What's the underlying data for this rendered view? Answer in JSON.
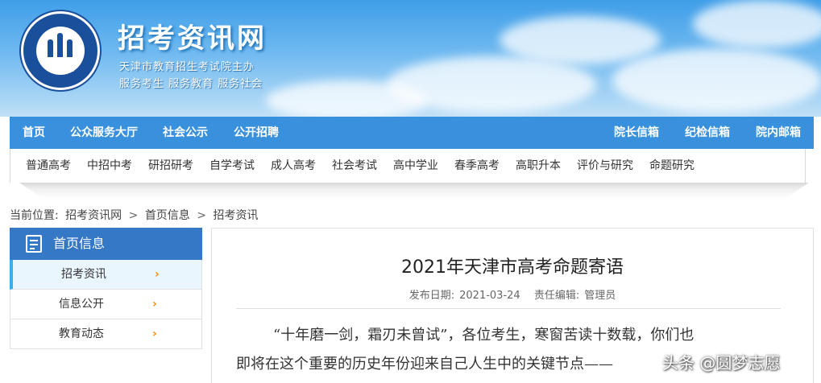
{
  "header": {
    "site_title": "招考资讯网",
    "logo_text": "TAEA",
    "subtitle_line1": "天津市教育招生考试院主办",
    "subtitle_line2": "服务考生 服务教育 服务社会"
  },
  "top_nav": {
    "left": [
      "首页",
      "公众服务大厅",
      "社会公示",
      "公开招聘"
    ],
    "right": [
      "院长信箱",
      "纪检信箱",
      "院内邮箱"
    ]
  },
  "sub_nav": [
    "普通高考",
    "中招中考",
    "研招研考",
    "自学考试",
    "成人高考",
    "社会考试",
    "高中学业",
    "春季高考",
    "高职升本",
    "评价与研究",
    "命题研究"
  ],
  "breadcrumb": {
    "prefix": "当前位置:",
    "items": [
      "招考资讯网",
      "首页信息",
      "招考资讯"
    ],
    "separator": ">"
  },
  "sidebar": {
    "title": "首页信息",
    "items": [
      {
        "label": "招考资讯",
        "arrow": "›",
        "active": true
      },
      {
        "label": "信息公开",
        "arrow": "›",
        "active": false
      },
      {
        "label": "教育动态",
        "arrow": "›",
        "active": false
      }
    ]
  },
  "article": {
    "title": "2021年天津市高考命题寄语",
    "date_label": "发布日期:",
    "date": "2021-03-24",
    "editor_label": "责任编辑:",
    "editor": "管理员",
    "para_line1": "“十年磨一剑，霜刃未曾试”，各位考生，寒窗苦读十数载，你们也",
    "para_line2": "即将在这个重要的历史年份迎来自己人生中的关键节点——"
  },
  "watermark": {
    "text": "头条 @圆梦志愿"
  },
  "colors": {
    "nav_blue": "#3990dd",
    "sidebar_head": "#3578c6",
    "active_accent": "#39b1e6",
    "arrow_orange": "#f28c00"
  }
}
